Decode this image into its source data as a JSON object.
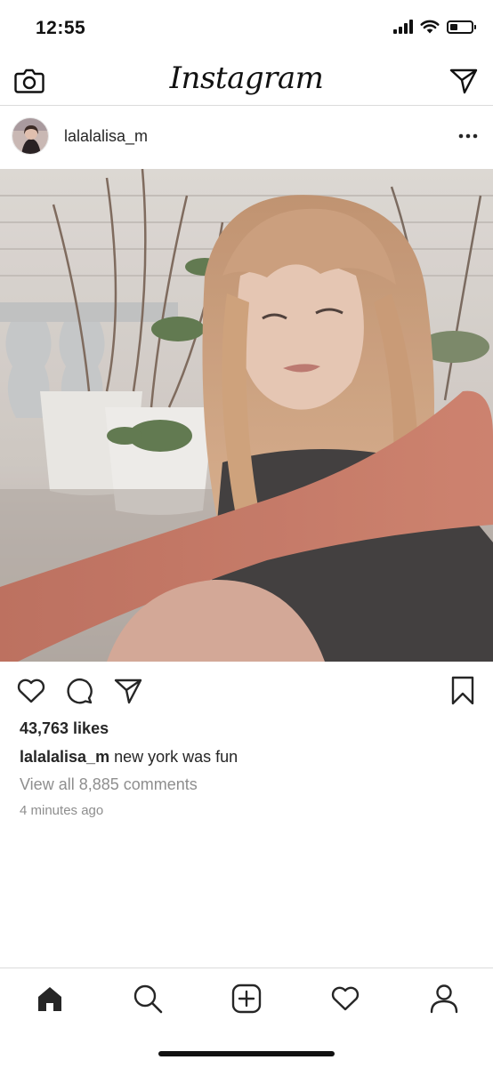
{
  "status_bar": {
    "time": "12:55",
    "battery_level": 0.35
  },
  "app": {
    "title": "Instagram"
  },
  "post": {
    "username": "lalalalisa_m",
    "likes": "43,763 likes",
    "caption_user": "lalalalisa_m",
    "caption_text": "new york was fun",
    "comments_link": "View all 8,885 comments",
    "timestamp": "4 minutes ago"
  },
  "icons": {
    "top_left": "camera-icon",
    "top_right": "direct-message-icon",
    "post_more": "more-options-icon",
    "actions": [
      "heart-icon",
      "comment-icon",
      "share-icon",
      "bookmark-icon"
    ],
    "tabs": [
      "home-icon",
      "search-icon",
      "add-post-icon",
      "activity-heart-icon",
      "profile-icon"
    ]
  },
  "colors": {
    "text": "#262626",
    "muted": "#8e8e8e",
    "divider": "#dbdbdb"
  }
}
